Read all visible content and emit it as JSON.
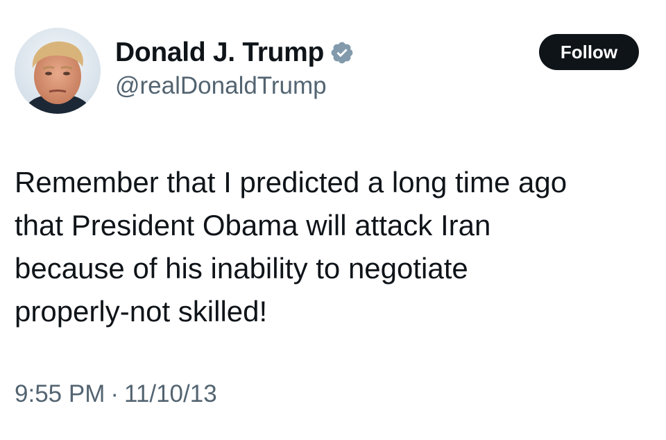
{
  "author": {
    "display_name": "Donald J. Trump",
    "handle": "@realDonaldTrump",
    "verified": true,
    "verified_icon": "verified-badge-icon",
    "verified_color": "#829aab"
  },
  "follow_button": {
    "label": "Follow",
    "bg_color": "#0f1419",
    "text_color": "#ffffff"
  },
  "tweet": {
    "lines": [
      "Remember that I predicted a long time ago",
      "that President Obama will attack Iran",
      "because of his inability to negotiate",
      "properly-not skilled!"
    ]
  },
  "meta": {
    "time": "9:55 PM",
    "separator": "·",
    "date": "11/10/13"
  },
  "colors": {
    "text_primary": "#0f1419",
    "text_secondary": "#536471",
    "background": "#ffffff"
  }
}
